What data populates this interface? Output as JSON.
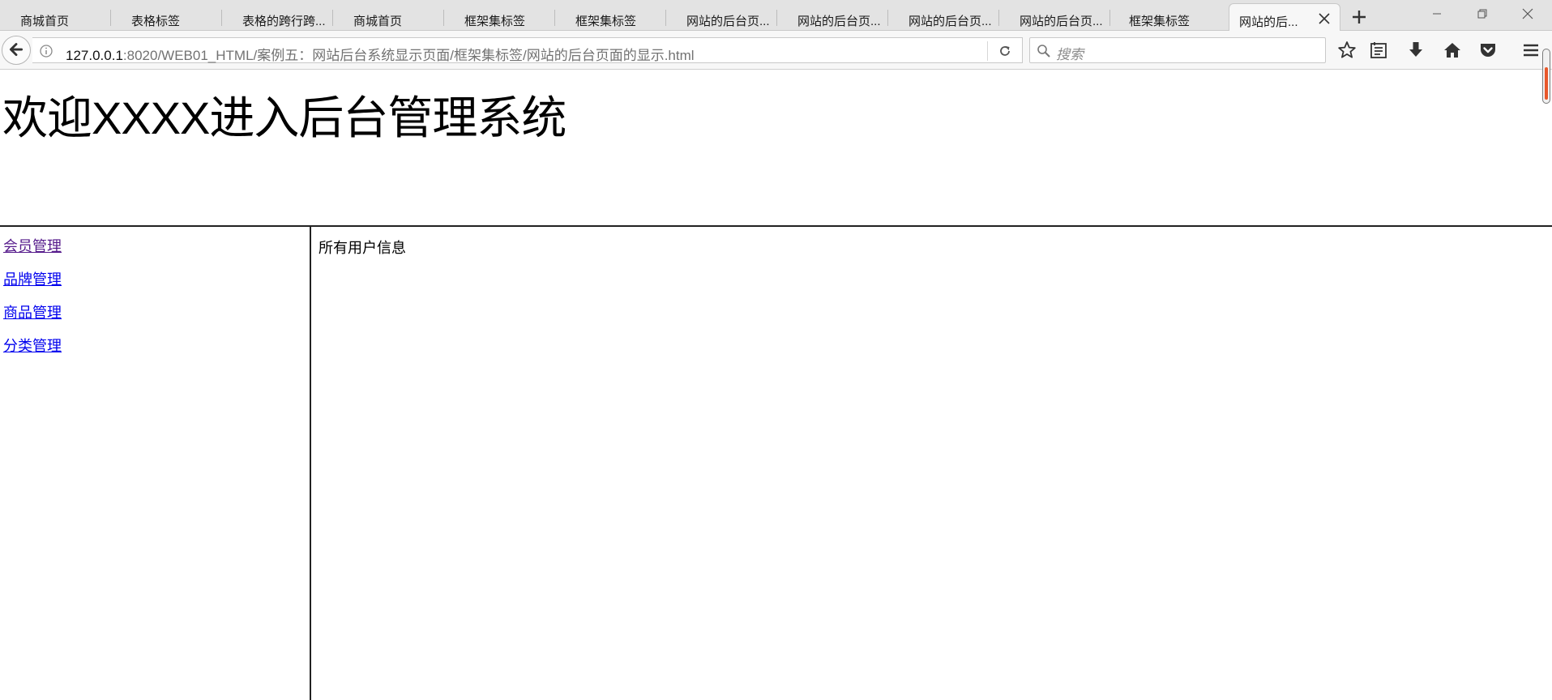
{
  "browser": {
    "tabs": [
      {
        "label": "商城首页",
        "active": false
      },
      {
        "label": "表格标签",
        "active": false
      },
      {
        "label": "表格的跨行跨...",
        "active": false
      },
      {
        "label": "商城首页",
        "active": false
      },
      {
        "label": "框架集标签",
        "active": false
      },
      {
        "label": "框架集标签",
        "active": false
      },
      {
        "label": "网站的后台页...",
        "active": false
      },
      {
        "label": "网站的后台页...",
        "active": false
      },
      {
        "label": "网站的后台页...",
        "active": false
      },
      {
        "label": "网站的后台页...",
        "active": false
      },
      {
        "label": "框架集标签",
        "active": false
      },
      {
        "label": "网站的后...",
        "active": true
      }
    ],
    "url": {
      "host": "127.0.0.1",
      "path": ":8020/WEB01_HTML/案例五：网站后台系统显示页面/框架集标签/网站的后台页面的显示.html"
    },
    "search_placeholder": "搜索",
    "icons": {
      "back": "back-arrow-icon",
      "info": "info-icon",
      "reload": "reload-icon",
      "search": "search-icon",
      "bookmark": "star-icon",
      "reading_list": "reading-list-icon",
      "download": "download-icon",
      "home": "home-icon",
      "pocket": "pocket-icon",
      "menu": "hamburger-menu-icon"
    }
  },
  "page": {
    "title": "欢迎XXXX进入后台管理系统",
    "nav": [
      {
        "label": "会员管理",
        "visited": true
      },
      {
        "label": "品牌管理",
        "visited": false
      },
      {
        "label": "商品管理",
        "visited": false
      },
      {
        "label": "分类管理",
        "visited": false
      }
    ],
    "main_text": "所有用户信息"
  },
  "colors": {
    "link": "#0000ee",
    "link_visited": "#551a8b",
    "frame_border": "#222222",
    "tabstrip_bg": "#e3e3e3",
    "toolbar_bg": "#f7f7f7"
  }
}
